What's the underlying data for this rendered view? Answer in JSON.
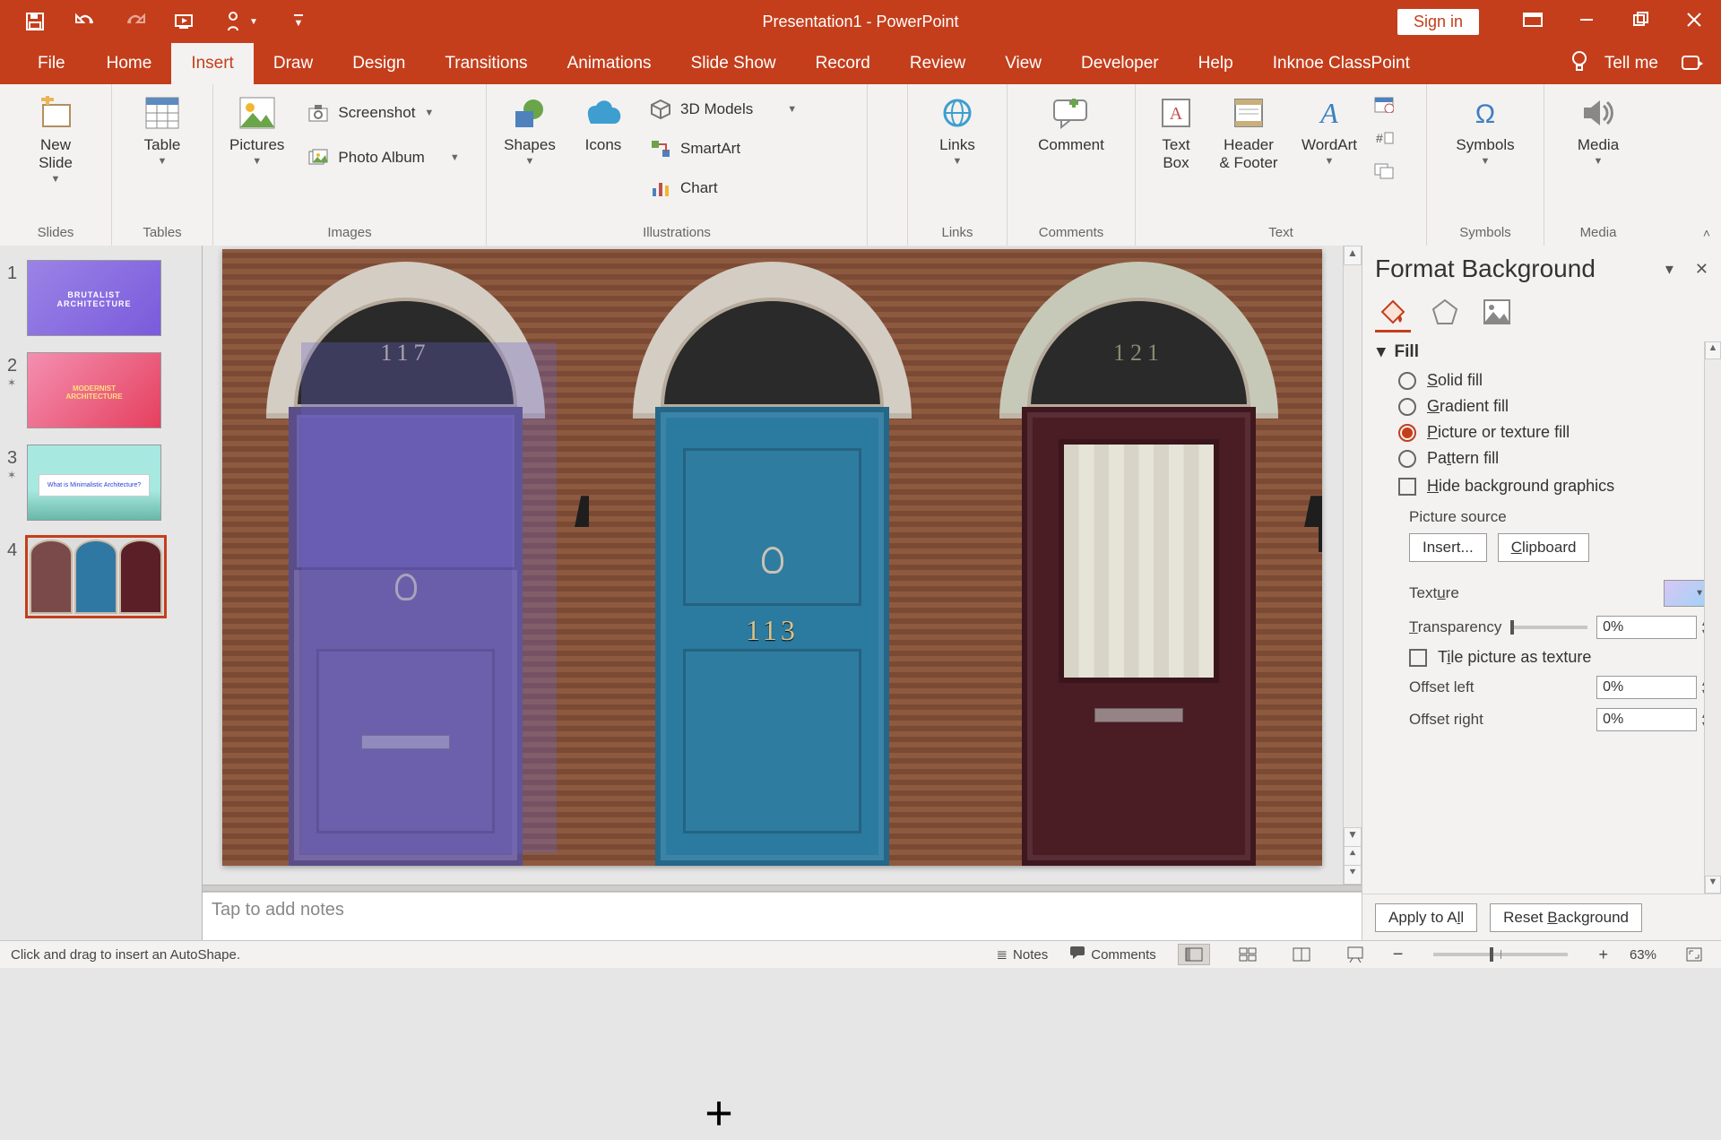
{
  "title": "Presentation1  -  PowerPoint",
  "signin": "Sign in",
  "tellme": "Tell me",
  "tabs": {
    "file": "File",
    "home": "Home",
    "insert": "Insert",
    "draw": "Draw",
    "design": "Design",
    "transitions": "Transitions",
    "animations": "Animations",
    "slideshow": "Slide Show",
    "record": "Record",
    "review": "Review",
    "view": "View",
    "developer": "Developer",
    "help": "Help",
    "classpoint": "Inknoe ClassPoint"
  },
  "ribbon": {
    "groups": {
      "slides": "Slides",
      "tables": "Tables",
      "images": "Images",
      "illustrations": "Illustrations",
      "links": "Links",
      "comments": "Comments",
      "text": "Text",
      "symbols": "Symbols",
      "media": "Media"
    },
    "new_slide": "New\nSlide",
    "table": "Table",
    "pictures": "Pictures",
    "screenshot": "Screenshot",
    "photo_album": "Photo Album",
    "shapes": "Shapes",
    "icons": "Icons",
    "models3d": "3D Models",
    "smartart": "SmartArt",
    "chart": "Chart",
    "links_btn": "Links",
    "comment": "Comment",
    "textbox": "Text\nBox",
    "headerfooter": "Header\n& Footer",
    "wordart": "WordArt",
    "symbols_btn": "Symbols",
    "media_btn": "Media"
  },
  "thumbs": {
    "t1": "BRUTALIST\nARCHITECTURE",
    "t2": "MODERNIST\nARCHITECTURE",
    "t3": "What is Minimalistic Architecture?"
  },
  "doors": {
    "num1": "117",
    "num2": "113",
    "num3": "121"
  },
  "notes_placeholder": "Tap to add notes",
  "pane": {
    "title": "Format Background",
    "fill": "Fill",
    "solid": "olid fill",
    "solid_pre": "S",
    "gradient": "radient fill",
    "gradient_pre": "G",
    "picture": "icture or texture fill",
    "picture_pre": "P",
    "pattern": "ttern fill",
    "pattern_pre": "Pa",
    "hide_pre": "H",
    "hide": "ide background graphics",
    "pic_source": "Picture source",
    "insert": "Insert...",
    "clipboard_pre": "C",
    "clipboard": "lipboard",
    "texture": "re",
    "texture_pre": "Textu",
    "transparency": "ransparency",
    "transparency_pre": "T",
    "transparency_val": "0%",
    "tile_pre": "T",
    "tile": "ile picture as texture",
    "offset_left": "Offset left",
    "offset_left_val": "0%",
    "offset_right": "Offset right",
    "offset_right_val": "0%",
    "apply": "Apply to All",
    "reset_pre": "B",
    "reset_a": "Reset ",
    "reset_b": "ackground"
  },
  "status": {
    "msg": "Click and drag to insert an AutoShape.",
    "notes": "Notes",
    "comments": "Comments",
    "zoom": "63%"
  }
}
